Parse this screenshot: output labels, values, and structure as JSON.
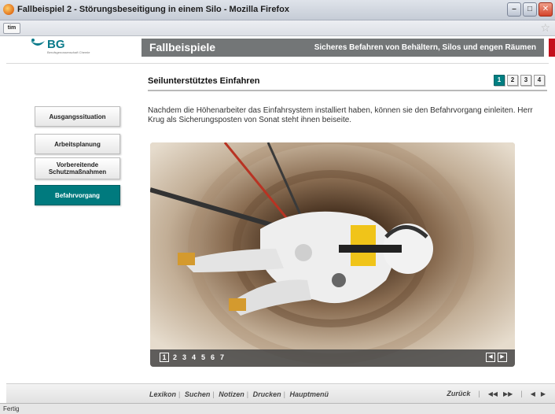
{
  "window": {
    "title": "Fallbeispiel 2 - Störungsbeseitigung in einem Silo - Mozilla Firefox",
    "tab_label": "tim",
    "status": "Fertig"
  },
  "header": {
    "logo_text": "BG",
    "logo_sub": "Berufsgenossenschaft Chemie",
    "title": "Fallbeispiele",
    "subtitle": "Sicheres Befahren von Behältern, Silos und engen Räumen"
  },
  "page": {
    "title": "Seilunterstütztes Einfahren",
    "pages": [
      "1",
      "2",
      "3",
      "4"
    ],
    "active_page": "1",
    "description": "Nachdem die Höhenarbeiter das Einfahrsystem installiert haben, können sie den Befahrvorgang einleiten. Herr Krug als Sicherungsposten von Sonat steht ihnen beiseite."
  },
  "sidebar": {
    "items": [
      {
        "label": "Ausgangssituation"
      },
      {
        "label": "Arbeitsplanung"
      },
      {
        "label": "Vorbereitende Schutzmaßnahmen"
      },
      {
        "label": "Befahrvorgang"
      }
    ],
    "active": "Befahrvorgang"
  },
  "gallery": {
    "images": [
      "1",
      "2",
      "3",
      "4",
      "5",
      "6",
      "7"
    ],
    "active_image": "1"
  },
  "footer": {
    "links": [
      "Lexikon",
      "Suchen",
      "Notizen",
      "Drucken",
      "Hauptmenü"
    ],
    "back_label": "Zurück"
  },
  "colors": {
    "accent": "#007f82",
    "header_bar": "#737677",
    "brand_red": "#c4101c"
  }
}
